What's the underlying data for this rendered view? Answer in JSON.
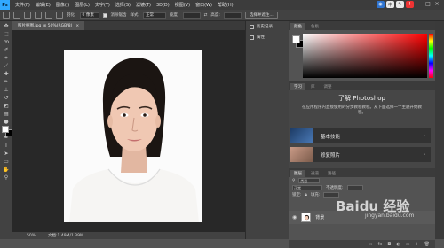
{
  "app": {
    "logo": "Ps"
  },
  "menubar": {
    "items": [
      "文件(F)",
      "编辑(E)",
      "图像(I)",
      "图层(L)",
      "文字(Y)",
      "选择(S)",
      "滤镜(T)",
      "3D(D)",
      "视图(V)",
      "窗口(W)",
      "帮助(H)"
    ]
  },
  "options": {
    "feather_label": "羽化:",
    "feather_value": "0 像素",
    "antialias_label": "消除锯齿",
    "style_label": "样式:",
    "style_value": "正常",
    "width_label": "宽度:",
    "height_label": "高度:",
    "select_mask_btn": "选择并遮住..."
  },
  "document": {
    "tab": "照片抠图.jpg @ 50%(RGB/8)",
    "close": "×"
  },
  "status": {
    "zoom": "50%",
    "doc": "文档:1.49M/1.39M"
  },
  "dock": {
    "history_label": "历史记录",
    "properties_label": "属性"
  },
  "color_panel": {
    "tabs": [
      "颜色",
      "色板"
    ]
  },
  "learn_panel": {
    "tabs": [
      "学习",
      "库",
      "调整"
    ],
    "title": "了解 Photoshop",
    "description": "在应用程序内直接使用的分步教程教程。从下面选择一个主题开始教程。",
    "cards": [
      {
        "label": "基本技能"
      },
      {
        "label": "修复照片"
      }
    ]
  },
  "layers_panel": {
    "tabs": [
      "图层",
      "通道",
      "路径"
    ],
    "filter_label": "类型",
    "blend_mode": "正常",
    "opacity_label": "不透明度:",
    "lock_label": "锁定:",
    "fill_label": "填充:",
    "layer_name": "背景"
  },
  "watermark": {
    "text": "Baidu 经验",
    "url": "jingyan.baidu.com"
  },
  "colors": {
    "accent": "#31a8ff",
    "panel": "#535353",
    "canvas": "#282828"
  }
}
